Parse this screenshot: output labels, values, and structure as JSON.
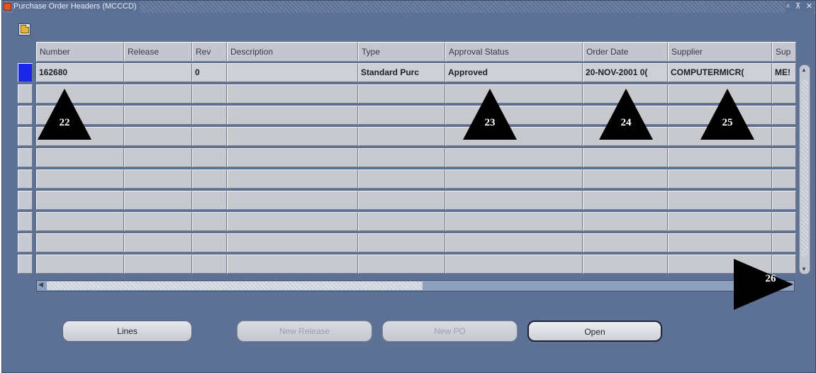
{
  "window": {
    "title": "Purchase Order Headers (MCCCD)",
    "controls": "⩡ ⊼ ✕"
  },
  "columns": [
    "Number",
    "Release",
    "Rev",
    "Description",
    "Type",
    "Approval Status",
    "Order Date",
    "Supplier",
    "Sup"
  ],
  "rows": [
    {
      "number": "162680",
      "release": "",
      "rev": "0",
      "description": "",
      "type": "Standard Purc",
      "approval_status": "Approved",
      "order_date": "20-NOV-2001 0(",
      "supplier": "COMPUTERMICR(",
      "sup": "ME!"
    }
  ],
  "empty_row_count": 9,
  "buttons": {
    "lines": "Lines",
    "new_release": "New Release",
    "new_po": "New PO",
    "open": "Open"
  },
  "callouts": [
    "22",
    "23",
    "24",
    "25",
    "26"
  ],
  "colors": {
    "window_bg": "#5d7195",
    "active_row_marker": "#1a26e8",
    "cell_bg": "#c7c9cf",
    "callout": "#000000"
  }
}
